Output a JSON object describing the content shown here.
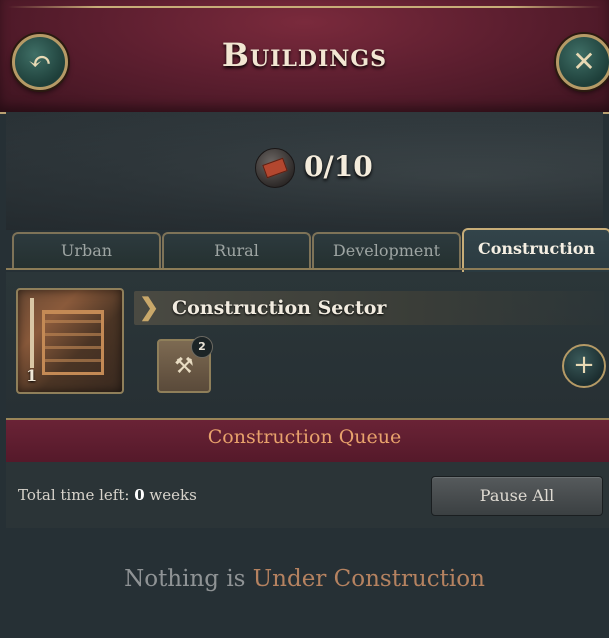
{
  "window": {
    "title": "Buildings",
    "back_icon": "back-arrow-icon",
    "close_icon": "close-icon"
  },
  "capacity": {
    "icon": "construction-brick-icon",
    "value": "0/10"
  },
  "tabs": [
    {
      "label": "Urban",
      "active": false
    },
    {
      "label": "Rural",
      "active": false
    },
    {
      "label": "Development",
      "active": false
    },
    {
      "label": "Construction",
      "active": true
    }
  ],
  "sector": {
    "name": "Construction Sector",
    "level": "1",
    "slot_badge": "2",
    "slot_icon": "worker-hat-icon",
    "add_icon": "plus-icon"
  },
  "queue": {
    "title": "Construction Queue",
    "time_label": "Total time left:",
    "time_value": "0",
    "time_unit": "weeks",
    "pause_label": "Pause All",
    "empty_prefix": "Nothing is",
    "empty_highlight": "Under Construction"
  },
  "colors": {
    "header_bg": "#5e1f30",
    "accent_gold": "#c7ad78",
    "queue_title": "#e8a26c"
  }
}
